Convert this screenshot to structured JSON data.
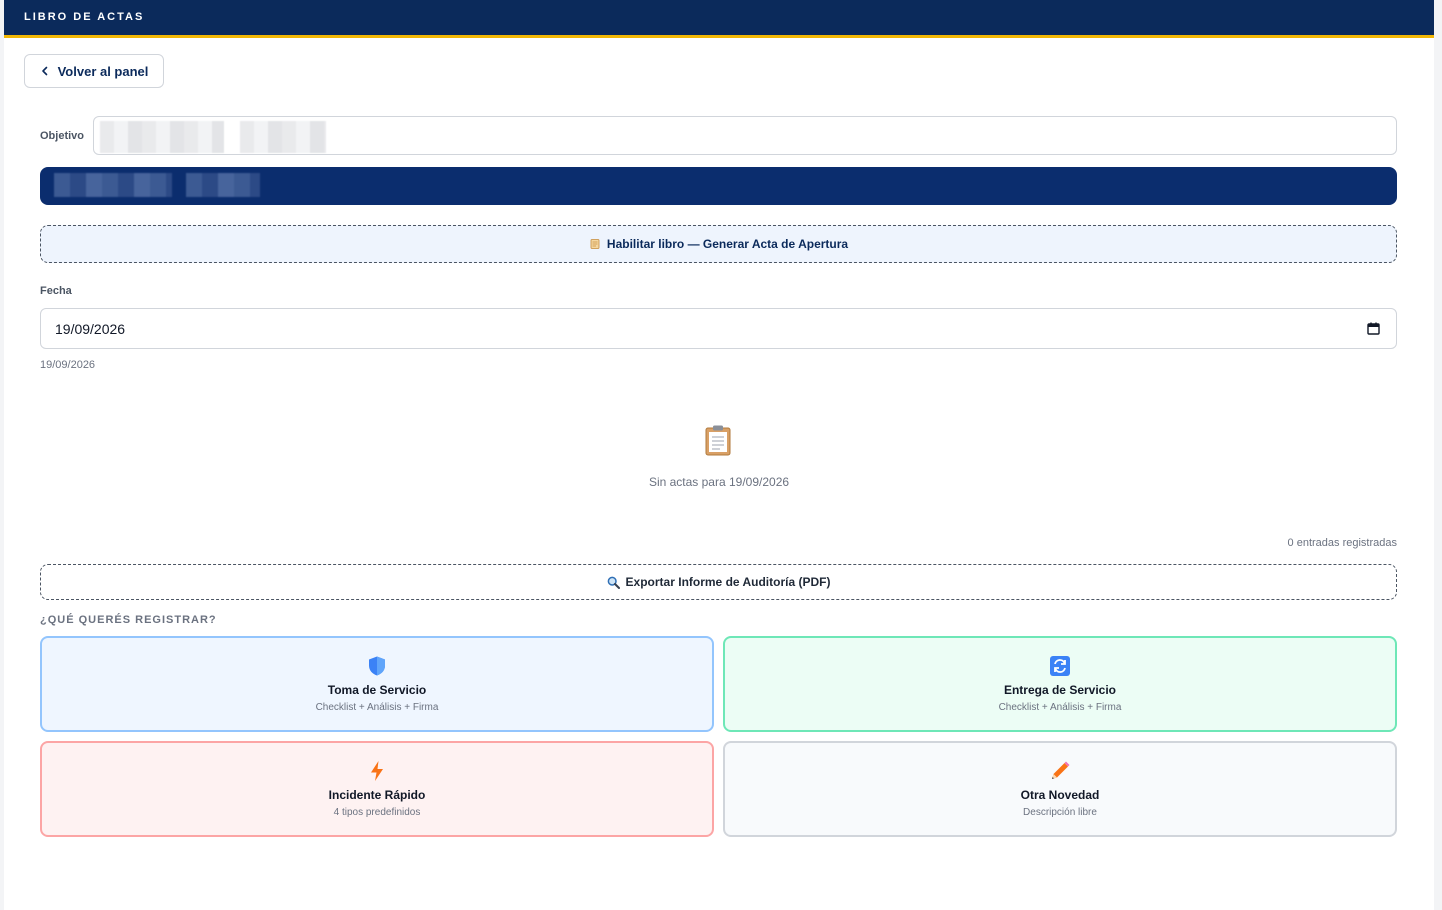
{
  "header": {
    "title": "LIBRO DE ACTAS"
  },
  "nav": {
    "back_label": "Volver al panel"
  },
  "objetivo": {
    "label": "Objetivo",
    "value": ""
  },
  "actions": {
    "habilitar_label": "Habilitar libro — Generar Acta de Apertura",
    "export_label": "Exportar Informe de Auditoría (PDF)"
  },
  "fecha": {
    "label": "Fecha",
    "value": "19/09/2026",
    "display": "19/09/2026"
  },
  "empty": {
    "message": "Sin actas para 19/09/2026",
    "icon": "clipboard-icon"
  },
  "entries": {
    "count_text": "0 entradas registradas"
  },
  "register": {
    "heading": "¿QUÉ QUERÉS REGISTRAR?",
    "cards": [
      {
        "title": "Toma de Servicio",
        "subtitle": "Checklist + Análisis + Firma",
        "icon": "shield-icon",
        "color": "#eff6ff"
      },
      {
        "title": "Entrega de Servicio",
        "subtitle": "Checklist + Análisis + Firma",
        "icon": "refresh-icon",
        "color": "#ecfdf5"
      },
      {
        "title": "Incidente Rápido",
        "subtitle": "4 tipos predefinidos",
        "icon": "lightning-icon",
        "color": "#fef2f2"
      },
      {
        "title": "Otra Novedad",
        "subtitle": "Descripción libre",
        "icon": "pencil-icon",
        "color": "#f8fafc"
      }
    ]
  },
  "colors": {
    "brand": "#0b2a5b",
    "accent": "#f2b705"
  }
}
